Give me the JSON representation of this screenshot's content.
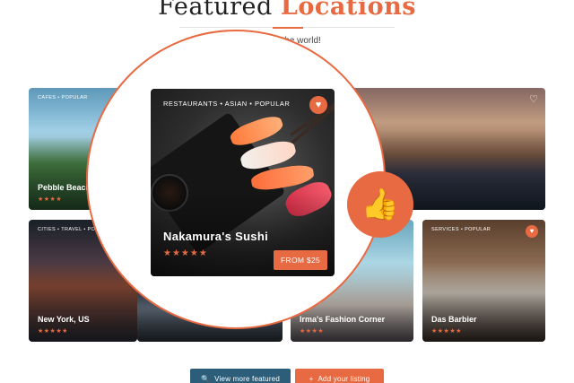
{
  "header": {
    "title_plain": "Featured",
    "title_accent": "Locations",
    "subtitle": "ding in the world!"
  },
  "cards": {
    "pebble": {
      "tags": "CAFES • POPULAR",
      "name": "Pebble Beach",
      "stars": "★★★★"
    },
    "venice": {
      "tags": "",
      "name": "",
      "stars": ""
    },
    "newyork": {
      "tags": "CITIES • TRAVEL • POPULAR",
      "name": "New York, US",
      "stars": "★★★★★"
    },
    "fashion": {
      "name": "Irma's Fashion Corner",
      "stars": "★★★★"
    },
    "barbier": {
      "tags": "SERVICES • POPULAR",
      "name": "Das Barbier",
      "stars": "★★★★★"
    }
  },
  "featured": {
    "tags": "RESTAURANTS • ASIAN • POPULAR",
    "name": "Nakamura's Sushi",
    "stars": "★★★★★",
    "price": "FROM $25"
  },
  "buttons": {
    "view_more": "View more featured",
    "add_listing": "Add your listing"
  },
  "icons": {
    "heart": "♡",
    "heart_filled": "♥",
    "thumbs_up": "👍",
    "search": "🔍",
    "plus": "+"
  },
  "colors": {
    "accent": "#e86a42",
    "button_dark": "#2c5e7a"
  }
}
